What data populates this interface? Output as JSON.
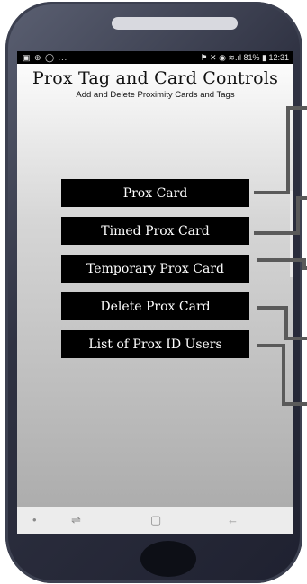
{
  "status_bar": {
    "left_icons": "▣ ⊕ ◯ ...",
    "right_text": "81%",
    "time": "12:31"
  },
  "header": {
    "title": "Prox Tag and Card Controls",
    "subtitle": "Add and Delete Proximity Cards and Tags"
  },
  "menu": {
    "buttons": [
      {
        "label": "Prox Card"
      },
      {
        "label": "Timed Prox Card"
      },
      {
        "label": "Temporary Prox Card"
      },
      {
        "label": "Delete Prox Card"
      },
      {
        "label": "List of Prox ID Users"
      }
    ]
  },
  "nav_bar": {
    "icons": [
      "dot-icon",
      "recent-apps-icon",
      "home-square-icon",
      "back-arrow-icon"
    ],
    "glyphs": [
      "•",
      "⇌",
      "▢",
      "←"
    ]
  },
  "colors": {
    "button_bg": "#000000",
    "button_text": "#ffffff",
    "phone_frame": "#2f3242",
    "connector_lines": "#5a5a5a"
  }
}
